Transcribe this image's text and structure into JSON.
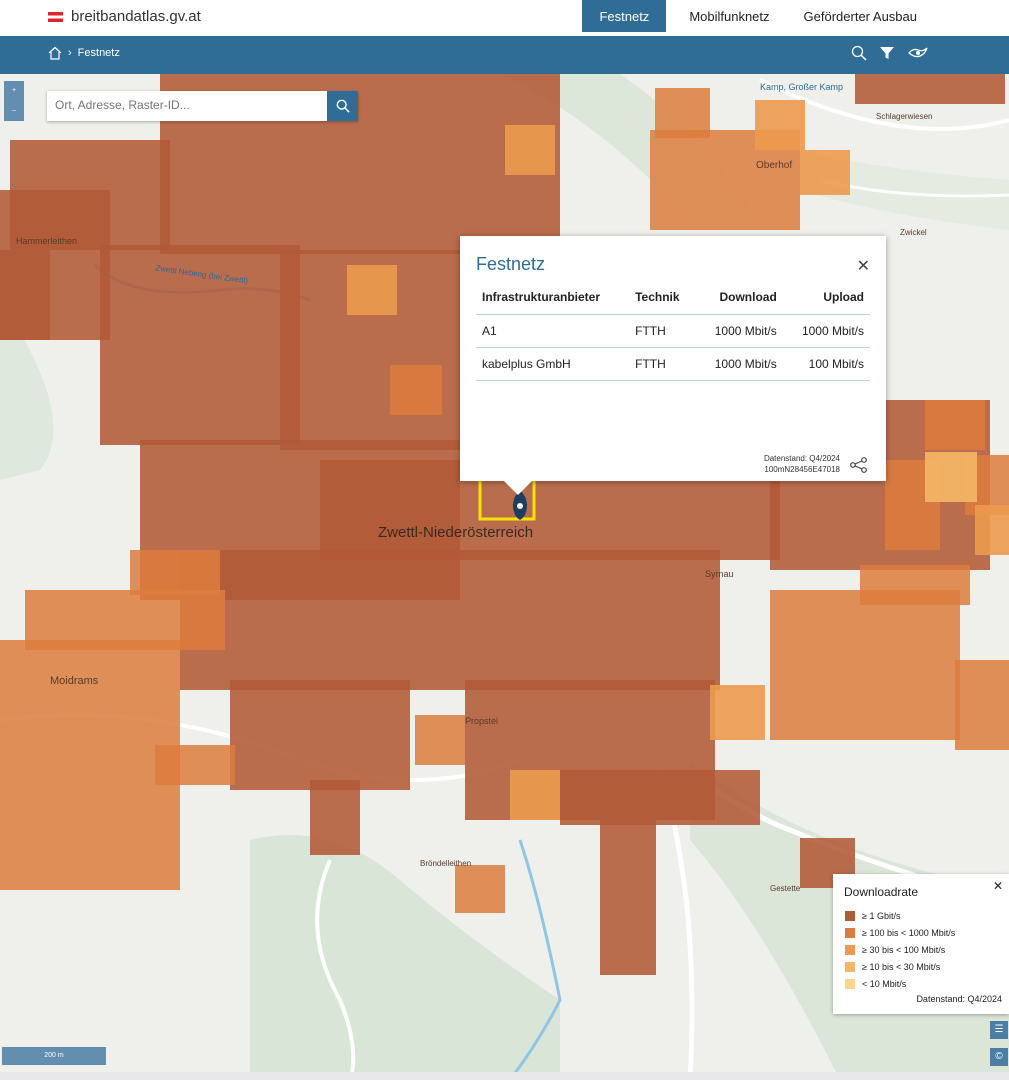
{
  "header": {
    "logo_text": "breitbandatlas.gv.at",
    "nav": [
      "Festnetz",
      "Mobilfunknetz",
      "Geförderter Ausbau"
    ],
    "active_nav": "Festnetz"
  },
  "toolbar": {
    "breadcrumb": "Festnetz",
    "icons": [
      "search-icon",
      "filter-icon",
      "location-icon"
    ]
  },
  "search": {
    "placeholder": "Ort, Adresse, Raster-ID..."
  },
  "map": {
    "city_label": "Zwettl-Niederösterreich",
    "place_labels": [
      "Moidrams",
      "Oberhof",
      "Schlagerwiesen",
      "Zwickel",
      "Propstei",
      "Bröndelleithen",
      "Gestette",
      "Kamp, Großer Kamp",
      "Zwettl Nebeng (bei Zwettl)",
      "Hammerleithen",
      "Syrnau"
    ],
    "scale_label": "200 m"
  },
  "popup": {
    "title": "Festnetz",
    "columns": [
      "Infrastrukturanbieter",
      "Technik",
      "Download",
      "Upload"
    ],
    "rows": [
      {
        "provider": "A1",
        "tech": "FTTH",
        "download": "1000 Mbit/s",
        "upload": "1000 Mbit/s"
      },
      {
        "provider": "kabelplus GmbH",
        "tech": "FTTH",
        "download": "1000 Mbit/s",
        "upload": "100 Mbit/s"
      }
    ],
    "data_date": "Datenstand: Q4/2024",
    "raster_id": "100mN28456E47018"
  },
  "legend": {
    "title": "Downloadrate",
    "items": [
      {
        "label": "≥ 1 Gbit/s",
        "color": "#b25a37"
      },
      {
        "label": "≥ 100 bis < 1000 Mbit/s",
        "color": "#dd7c3e"
      },
      {
        "label": "≥ 30 bis < 100 Mbit/s",
        "color": "#ec9a4e"
      },
      {
        "label": "≥ 10 bis < 30 Mbit/s",
        "color": "#f5b766"
      },
      {
        "label": "< 10 Mbit/s",
        "color": "#f9d58f"
      }
    ],
    "data_date": "Datenstand: Q4/2024"
  },
  "colors": {
    "brand_blue": "#2f6d97",
    "coverage_high": "#b25a37",
    "coverage_mid": "#dd7c3e",
    "coverage_light": "#ec9a4e"
  }
}
